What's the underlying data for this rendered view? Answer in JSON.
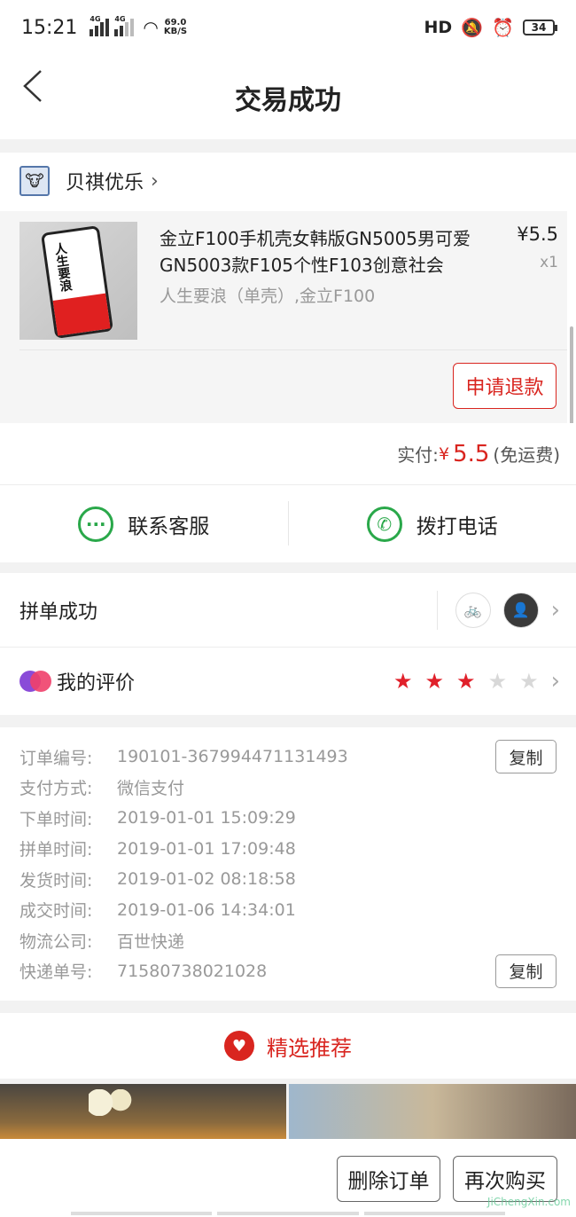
{
  "status_bar": {
    "time": "15:21",
    "net1": "4G",
    "net2": "4G",
    "speed_value": "69.0",
    "speed_unit": "KB/S",
    "hd": "HD",
    "battery": "34"
  },
  "header": {
    "title": "交易成功"
  },
  "shop": {
    "name": "贝祺优乐"
  },
  "item": {
    "title": "金立F100手机壳女韩版GN5005男可爱GN5003款F105个性F103创意社会",
    "spec": "人生要浪（单壳）,金立F100",
    "price": "¥5.5",
    "qty": "x1",
    "thumb_text": "人生要浪",
    "refund_label": "申请退款"
  },
  "payment": {
    "label": "实付:",
    "currency": "¥",
    "amount": "5.5",
    "note": "(免运费)"
  },
  "contact": {
    "service_label": "联系客服",
    "phone_label": "拨打电话"
  },
  "group": {
    "label": "拼单成功"
  },
  "review": {
    "label": "我的评价",
    "rating": 3,
    "max_rating": 5
  },
  "order_info": {
    "rows": [
      {
        "key": "订单编号:",
        "value": "190101-367994471131493",
        "copy": true
      },
      {
        "key": "支付方式:",
        "value": "微信支付"
      },
      {
        "key": "下单时间:",
        "value": "2019-01-01 15:09:29"
      },
      {
        "key": "拼单时间:",
        "value": "2019-01-01 17:09:48"
      },
      {
        "key": "发货时间:",
        "value": "2019-01-02 08:18:58"
      },
      {
        "key": "成交时间:",
        "value": "2019-01-06 14:34:01"
      },
      {
        "key": "物流公司:",
        "value": "百世快递"
      },
      {
        "key": "快递单号:",
        "value": "71580738021028",
        "copy": true
      }
    ],
    "copy_label": "复制"
  },
  "recommend": {
    "title": "精选推荐"
  },
  "bottom": {
    "delete_label": "删除订单",
    "rebuy_label": "再次购买"
  },
  "watermark": "JiChengXin.com",
  "colors": {
    "accent": "#d9251f",
    "green": "#2aa84a"
  }
}
